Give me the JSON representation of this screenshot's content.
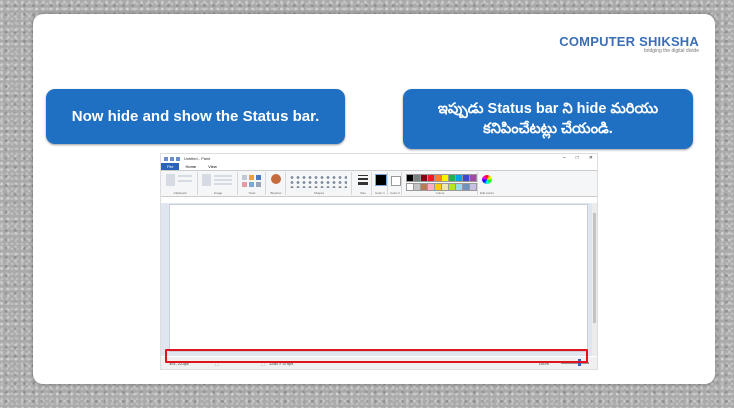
{
  "logo": {
    "brand": "COMPUTER SHIKSHA",
    "tagline": "bridging the digital divide"
  },
  "callouts": {
    "english": "Now hide and show the Status bar.",
    "telugu_line1": "ఇప్పుడు Status bar ని hide మరియు",
    "telugu_line2": "కనిపించేటట్లు చేయండి."
  },
  "paint": {
    "title": "Untitled - Paint",
    "tabs": [
      "File",
      "Home",
      "View"
    ],
    "ribbon_groups": [
      "Clipboard",
      "Image",
      "Tools",
      "Brushes",
      "Shapes",
      "Size",
      "Color 1",
      "Color 2",
      "Colors",
      "Edit colors"
    ],
    "palette": [
      "#000000",
      "#7f7f7f",
      "#880015",
      "#ed1c24",
      "#ff7f27",
      "#fff200",
      "#22b14c",
      "#00a2e8",
      "#3f48cc",
      "#a349a4",
      "#ffffff",
      "#c3c3c3",
      "#b97a57",
      "#ffaec9",
      "#ffc90e",
      "#efe4b0",
      "#b5e61d",
      "#99d9ea",
      "#7092be",
      "#c8bfe7"
    ],
    "status": {
      "position": "391, 223px",
      "selection": "",
      "size": "1280 × 479px",
      "zoom": "100%"
    }
  },
  "colors": {
    "callout": "#1f6fc2",
    "highlight": "#e0141c",
    "file_tab": "#2b63b8"
  }
}
